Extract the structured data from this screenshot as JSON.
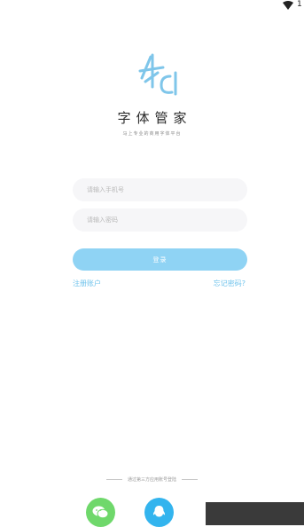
{
  "status_bar": {
    "time": "1"
  },
  "brand": {
    "title": "字体管家",
    "slogan": "马上专业的商用字体平台"
  },
  "form": {
    "phone_placeholder": "请输入手机号",
    "password_placeholder": "请输入密码",
    "login_label": "登录",
    "register_label": "注册账户",
    "forgot_label": "忘记密码?"
  },
  "third_party": {
    "divider_text": "通过第三方应用账号登陆"
  },
  "colors": {
    "accent": "#8fd3f4",
    "link": "#6fc3ec",
    "wechat": "#6fd86b",
    "qq": "#33b4ee"
  }
}
